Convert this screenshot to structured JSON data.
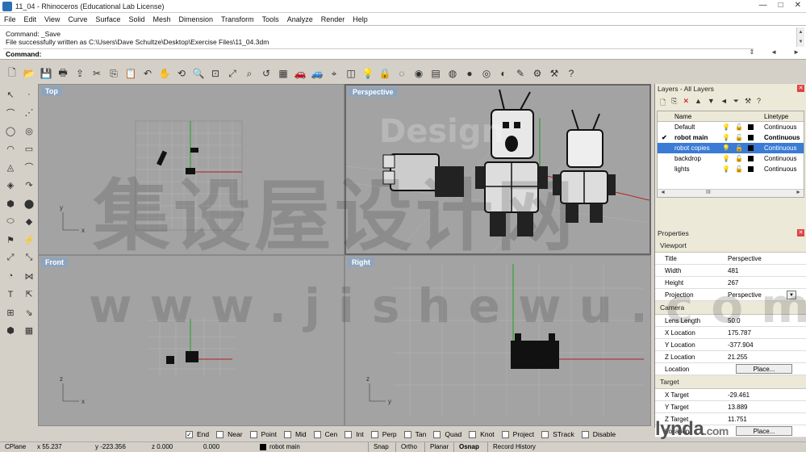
{
  "window": {
    "title": "11_04 - Rhinoceros (Educational Lab License)",
    "controls": [
      "—",
      "□",
      "✕"
    ]
  },
  "menu": [
    "File",
    "Edit",
    "View",
    "Curve",
    "Surface",
    "Solid",
    "Mesh",
    "Dimension",
    "Transform",
    "Tools",
    "Analyze",
    "Render",
    "Help"
  ],
  "command": {
    "history": [
      "Command: _Save",
      "File successfully written as C:\\Users\\Dave Schultze\\Desktop\\Exercise Files\\11_04.3dm"
    ],
    "prompt": "Command:",
    "controls": [
      "⇕",
      "◄",
      "►"
    ]
  },
  "toolbar_icons": [
    "new-file-icon",
    "open-folder-icon",
    "save-icon",
    "print-icon",
    "import-icon",
    "cut-icon",
    "copy-icon",
    "paste-icon",
    "undo-icon",
    "pan-hand-icon",
    "rotate-view-icon",
    "zoom-icon",
    "zoom-window-icon",
    "zoom-extents-icon",
    "zoom-selected-icon",
    "undo-view-icon",
    "four-viewports-icon",
    "car-icon",
    "car-render-icon",
    "set-cplane-icon",
    "cplane-icon",
    "light-bulb-icon",
    "lock-icon",
    "hide-icon",
    "show-icon",
    "layer-icon",
    "color-wheel-icon",
    "sphere-icon",
    "mesh-sphere-icon",
    "render-sphere-icon",
    "pencil-icon",
    "gear-icon",
    "options-icon",
    "help-icon"
  ],
  "toolbar_glyphs": [
    "🗋",
    "📂",
    "💾",
    "🖶",
    "⇪",
    "✂",
    "⎘",
    "📋",
    "↶",
    "✋",
    "⟲",
    "🔍",
    "⊡",
    "⤢",
    "⌕",
    "↺",
    "▦",
    "🚗",
    "🚙",
    "⌖",
    "◫",
    "💡",
    "🔒",
    "◌",
    "◉",
    "▤",
    "◍",
    "●",
    "◎",
    "◐",
    "✎",
    "⚙",
    "⚒",
    "?"
  ],
  "left_tool_glyphs": [
    "↖",
    "·",
    "⌒",
    "⋰",
    "◯",
    "◎",
    "◠",
    "▭",
    "◬",
    "⌒",
    "◈",
    "↷",
    "⬢",
    "⬤",
    "⬭",
    "◆",
    "⚑",
    "⚡",
    "⤢",
    "⤡",
    "◔",
    "⋈",
    "T",
    "⇱",
    "⊞",
    "⇘",
    "⬢",
    "▦"
  ],
  "viewports": {
    "top": {
      "label": "Top"
    },
    "perspective": {
      "label": "Perspective"
    },
    "front": {
      "label": "Front"
    },
    "right": {
      "label": "Right"
    }
  },
  "axis_labels": {
    "x": "x",
    "y": "y",
    "z": "z"
  },
  "layers": {
    "title": "Layers - All Layers",
    "toolbar": [
      "🗋",
      "⎘",
      "✕",
      "▲",
      "▼",
      "◄",
      "⏷",
      "⚒",
      "?"
    ],
    "headers": {
      "name": "Name",
      "linetype": "Linetype"
    },
    "rows": [
      {
        "name": "Default",
        "linetype": "Continuous",
        "current": false,
        "selected": false
      },
      {
        "name": "robot main",
        "linetype": "Continuous",
        "current": true,
        "selected": false
      },
      {
        "name": "robot copies",
        "linetype": "Continuous",
        "current": false,
        "selected": true
      },
      {
        "name": "backdrop",
        "linetype": "Continuous",
        "current": false,
        "selected": false
      },
      {
        "name": "lights",
        "linetype": "Continuous",
        "current": false,
        "selected": false
      }
    ],
    "current_mark": "✔",
    "scroll_glyphs": [
      "◄",
      "III",
      "►"
    ]
  },
  "properties": {
    "title": "Properties",
    "viewport_section": "Viewport",
    "title_label": "Title",
    "title_value": "Perspective",
    "width_label": "Width",
    "width_value": "481",
    "height_label": "Height",
    "height_value": "267",
    "projection_label": "Projection",
    "projection_value": "Perspective",
    "camera_section": "Camera",
    "lens_label": "Lens Length",
    "lens_value": "50.0",
    "xloc_label": "X Location",
    "xloc_value": "175.787",
    "yloc_label": "Y Location",
    "yloc_value": "-377.904",
    "zloc_label": "Z Location",
    "zloc_value": "21.255",
    "location_label": "Location",
    "place_button": "Place...",
    "target_section": "Target",
    "xt_label": "X Target",
    "xt_value": "-29.461",
    "yt_label": "Y Target",
    "yt_value": "13.889",
    "zt_label": "Z Target",
    "zt_value": "11.751",
    "tlocation_label": "Location",
    "tplace_button": "Place..."
  },
  "osnap": [
    {
      "label": "End",
      "checked": true
    },
    {
      "label": "Near",
      "checked": false
    },
    {
      "label": "Point",
      "checked": false
    },
    {
      "label": "Mid",
      "checked": false
    },
    {
      "label": "Cen",
      "checked": false
    },
    {
      "label": "Int",
      "checked": false
    },
    {
      "label": "Perp",
      "checked": false
    },
    {
      "label": "Tan",
      "checked": false
    },
    {
      "label": "Quad",
      "checked": false
    },
    {
      "label": "Knot",
      "checked": false
    },
    {
      "label": "Project",
      "checked": false
    },
    {
      "label": "STrack",
      "checked": false
    },
    {
      "label": "Disable",
      "checked": false
    }
  ],
  "status": {
    "cplane": "CPlane",
    "x": "x 55.237",
    "y": "y -223.356",
    "z": "z 0.000",
    "dist": "0.000",
    "layer": "robot main",
    "snap": "Snap",
    "ortho": "Ortho",
    "planar": "Planar",
    "osnap": "Osnap",
    "record": "Record History"
  },
  "watermark": {
    "cjk": "集设屋设计网",
    "url": "www.jishewu.com",
    "faint": "Design"
  },
  "logo": {
    "text": "lynda",
    "suffix": ".com"
  },
  "colors": {
    "viewport_bg": "#a3a3a3",
    "selected_layer": "#3a7bd5",
    "x_axis": "#b02020",
    "y_axis": "#20a020"
  }
}
